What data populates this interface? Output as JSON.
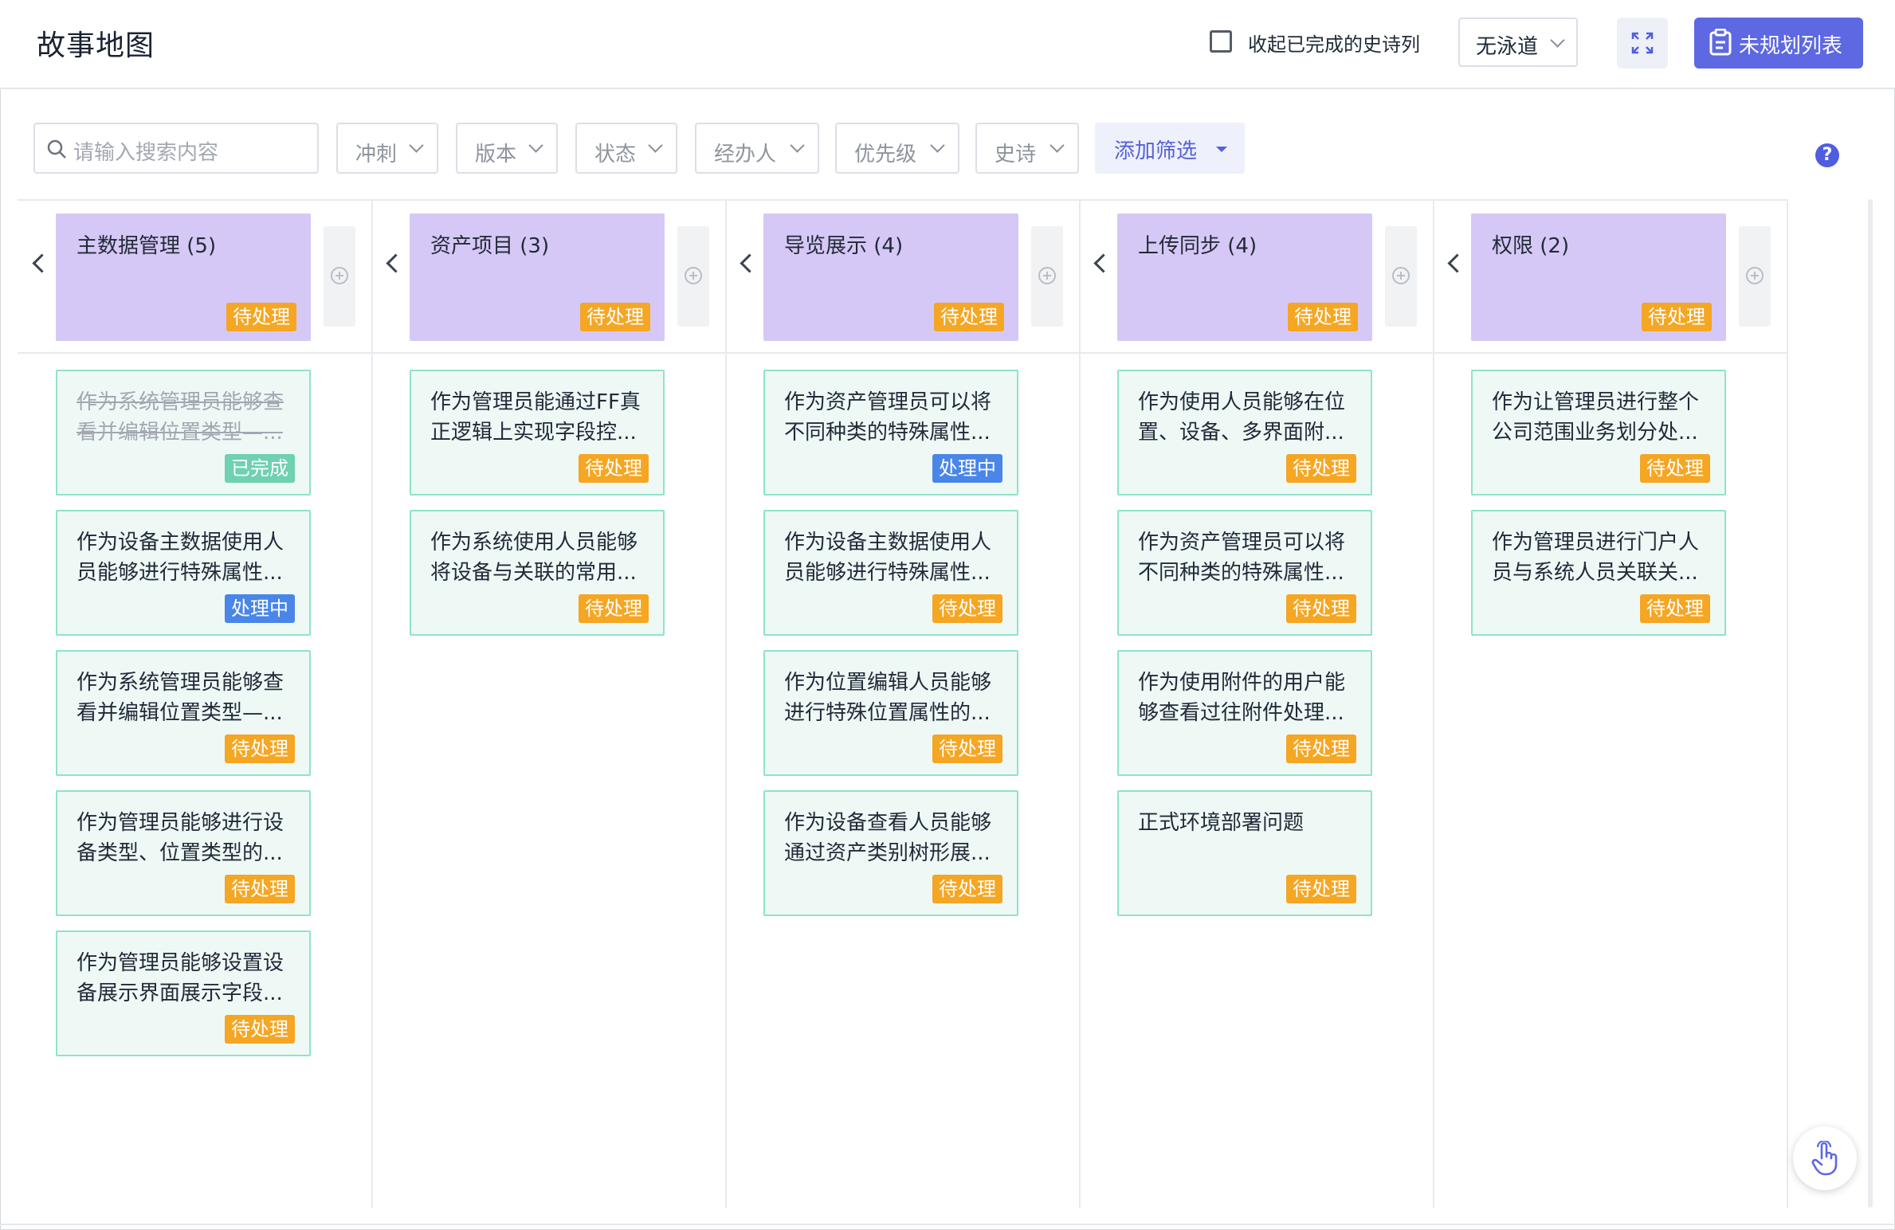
{
  "header": {
    "title": "故事地图",
    "collapse_label": "收起已完成的史诗列",
    "swimlane_value": "无泳道",
    "unplanned_label": "未规划列表"
  },
  "filters": {
    "search_placeholder": "请输入搜索内容",
    "selects": [
      "冲刺",
      "版本",
      "状态",
      "经办人",
      "优先级",
      "史诗"
    ],
    "add_filter_label": "添加筛选"
  },
  "help_label": "?",
  "colors": {
    "accent": "#5d68e2",
    "epic_bg": "#d6c8f6",
    "card_bg": "#eef9f6",
    "card_border": "#8fe3c8",
    "pending": "#f5a623",
    "in_progress": "#4a86e8",
    "done": "#6fd0b2"
  },
  "epics": [
    {
      "name": "主数据管理  (5)",
      "status": "待处理",
      "stories": [
        {
          "text": "作为系统管理员能够查看并编辑位置类型—...",
          "status": "已完成",
          "state": "done"
        },
        {
          "text": "作为设备主数据使用人员能够进行特殊属性...",
          "status": "处理中",
          "state": "doing"
        },
        {
          "text": "作为系统管理员能够查看并编辑位置类型—...",
          "status": "待处理",
          "state": "pending"
        },
        {
          "text": "作为管理员能够进行设备类型、位置类型的...",
          "status": "待处理",
          "state": "pending"
        },
        {
          "text": "作为管理员能够设置设备展示界面展示字段...",
          "status": "待处理",
          "state": "pending"
        }
      ]
    },
    {
      "name": "资产项目  (3)",
      "status": "待处理",
      "stories": [
        {
          "text": "作为管理员能通过FF真正逻辑上实现字段控...",
          "status": "待处理",
          "state": "pending"
        },
        {
          "text": "作为系统使用人员能够将设备与关联的常用...",
          "status": "待处理",
          "state": "pending"
        }
      ]
    },
    {
      "name": "导览展示  (4)",
      "status": "待处理",
      "stories": [
        {
          "text": "作为资产管理员可以将不同种类的特殊属性...",
          "status": "处理中",
          "state": "doing"
        },
        {
          "text": "作为设备主数据使用人员能够进行特殊属性...",
          "status": "待处理",
          "state": "pending"
        },
        {
          "text": "作为位置编辑人员能够进行特殊位置属性的...",
          "status": "待处理",
          "state": "pending"
        },
        {
          "text": "作为设备查看人员能够通过资产类别树形展...",
          "status": "待处理",
          "state": "pending"
        }
      ]
    },
    {
      "name": "上传同步  (4)",
      "status": "待处理",
      "stories": [
        {
          "text": "作为使用人员能够在位置、设备、多界面附...",
          "status": "待处理",
          "state": "pending"
        },
        {
          "text": "作为资产管理员可以将不同种类的特殊属性...",
          "status": "待处理",
          "state": "pending"
        },
        {
          "text": "作为使用附件的用户能够查看过往附件处理...",
          "status": "待处理",
          "state": "pending"
        },
        {
          "text": "正式环境部署问题",
          "status": "待处理",
          "state": "pending"
        }
      ]
    },
    {
      "name": "权限  (2)",
      "status": "待处理",
      "stories": [
        {
          "text": "作为让管理员进行整个公司范围业务划分处...",
          "status": "待处理",
          "state": "pending"
        },
        {
          "text": "作为管理员进行门户人员与系统人员关联关...",
          "status": "待处理",
          "state": "pending"
        }
      ]
    }
  ]
}
